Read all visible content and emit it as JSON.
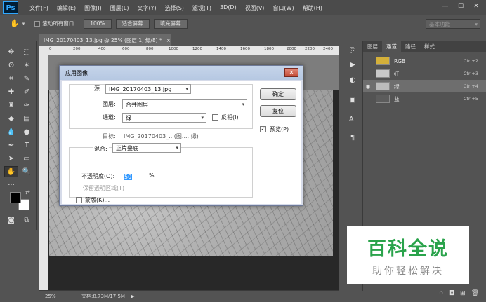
{
  "app": {
    "logo": "Ps"
  },
  "menubar": {
    "items": [
      "文件(F)",
      "编辑(E)",
      "图像(I)",
      "图层(L)",
      "文字(Y)",
      "选择(S)",
      "滤镜(T)",
      "3D(D)",
      "视图(V)",
      "窗口(W)",
      "帮助(H)"
    ],
    "minimize": "—",
    "restore": "☐",
    "close": "✕"
  },
  "optionsbar": {
    "scroll_all": "滚动所有窗口",
    "zoom": "100%",
    "fit_screen": "适合屏幕",
    "fill_screen": "填充屏幕",
    "workspace": "基本功能"
  },
  "document": {
    "tab_title": "IMG_20170403_13.jpg @ 25% (图层 1, 绿/8) *",
    "tab_close": "×",
    "ruler_ticks": [
      "0",
      "200",
      "400",
      "600",
      "800",
      "1000",
      "1200",
      "1400",
      "1600",
      "1800",
      "2000",
      "2200",
      "2400"
    ],
    "zoom": "25%",
    "doc_size": "文档:8.73M/17.5M"
  },
  "panel": {
    "tabs": [
      "图层",
      "通道",
      "路径",
      "样式"
    ],
    "active_tab": "通道",
    "channels": [
      {
        "name": "RGB",
        "shortcut": "Ctrl+2",
        "thumb": "#d4b03a",
        "visible": false,
        "selected": false
      },
      {
        "name": "红",
        "shortcut": "Ctrl+3",
        "thumb": "#c8c8c8",
        "visible": false,
        "selected": false
      },
      {
        "name": "绿",
        "shortcut": "Ctrl+4",
        "thumb": "#bcbcbc",
        "visible": true,
        "selected": true
      },
      {
        "name": "蓝",
        "shortcut": "Ctrl+5",
        "thumb": "#5c5c5c",
        "visible": false,
        "selected": false
      }
    ]
  },
  "dialog": {
    "title": "应用图像",
    "close": "✕",
    "source_label": "源:",
    "source_value": "IMG_20170403_13.jpg",
    "layer_label": "图层:",
    "layer_value": "合并图层",
    "channel_label": "通道:",
    "channel_value": "绿",
    "invert_label": "反相(I)",
    "target_label": "目标:",
    "target_value": "IMG_20170403_...(图..., 绿)",
    "blend_label": "混合:",
    "blend_value": "正片叠底",
    "opacity_label": "不透明度(O):",
    "opacity_value": "50",
    "opacity_unit": "%",
    "preserve_label": "保留透明区域(T)",
    "mask_label": "蒙版(K)...",
    "ok": "确定",
    "reset": "复位",
    "preview_label": "预览(P)",
    "preview_checked": "✓"
  },
  "watermark": {
    "title": "百科全说",
    "subtitle": "助你轻松解决"
  },
  "colors": {
    "foreground": "#000000",
    "background": "#ffffff",
    "watermark_green": "#2aa34b"
  }
}
